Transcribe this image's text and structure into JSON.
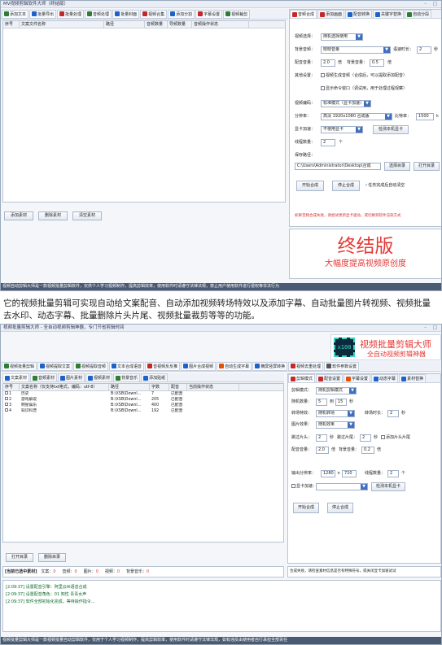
{
  "win1": {
    "title": "MV视频剪辑软件大师（终结版）",
    "win_controls": "– □",
    "toolbar": [
      {
        "label": "添加文本",
        "icon": "add-text-icon",
        "color": "#2e7d32"
      },
      {
        "label": "批量导出",
        "icon": "export-icon",
        "color": "#1e62c9"
      },
      {
        "label": "批量处理",
        "icon": "batch-icon",
        "color": "#c62828"
      },
      {
        "label": "音频处理",
        "icon": "audio-icon",
        "color": "#2e7d32"
      },
      {
        "label": "批量封面",
        "icon": "cover-icon",
        "color": "#1e62c9"
      },
      {
        "label": "视频合集",
        "icon": "merge-icon",
        "color": "#c62828"
      },
      {
        "label": "添加分割",
        "icon": "split-icon",
        "color": "#1e62c9"
      },
      {
        "label": "字幕设置",
        "icon": "subtitle-icon",
        "color": "#c62828"
      },
      {
        "label": "视频裁剪",
        "icon": "crop-icon",
        "color": "#2e7d32"
      }
    ],
    "grid_headers": [
      "序号",
      "文案文件名称",
      "路径",
      "音频数量",
      "导频数量",
      "音频操作状态"
    ],
    "buttons": {
      "add": "添加素材",
      "delete": "删除素材",
      "clear": "清空素材"
    },
    "tabs": [
      {
        "label": "音频合成",
        "icon": "audio-merge-icon",
        "color": "#c62828"
      },
      {
        "label": "添加画面",
        "icon": "picture-icon",
        "color": "#c62828"
      },
      {
        "label": "配音转换",
        "icon": "dub-icon",
        "color": "#1e62c9"
      },
      {
        "label": "关键字替换",
        "icon": "keyword-icon",
        "color": "#1e62c9"
      },
      {
        "label": "自动分段",
        "icon": "segment-icon",
        "color": "#2e7d32"
      }
    ],
    "settings": {
      "mode_label": "视频选择：",
      "mode_value": "随机选择使用",
      "voice_label": "背景音频：",
      "voice_value": "晓晓音量",
      "speed_label": "语速时长：",
      "speed_value": "2",
      "speed_unit": "秒",
      "vol_label": "配音音量：",
      "vol_value": "2.0",
      "vol_unit": "倍",
      "bg_label": "背景音量：",
      "bg_value": "0.5",
      "bg_unit": "倍",
      "other_label": "其他设置：",
      "opt1": "视频生成音频（合成后，可以提取添加配音）",
      "opt2": "显示命令窗口（调试用，用于处理过程观察）",
      "enc_label": "视频编码：",
      "enc_value": "标准模式（显卡加速）",
      "res_label": "分辨率：",
      "res_value": "高清 1920x1080 合成版",
      "ratio_label": "比特率：",
      "ratio_value": "1500",
      "ratio_unit": "k",
      "gpu_label": "显卡加速：",
      "gpu_value": "不使用显卡",
      "gpu_btn": "检测本机显卡",
      "threads_label": "线程数量：",
      "threads_value": "2",
      "threads_unit": "个",
      "out_label": "保存路径：",
      "out_value": "C:\\Users\\Administrator\\Desktop\\合成",
      "browse_btn": "选择目录",
      "open_btn": "打开目录",
      "start_btn": "开始合成",
      "stop_btn": "停止合成",
      "auto_clear": "任务完成后自动清空",
      "warning": "如果音频合成失败，请尝试更新显卡驱动，或切换到软件渲染方式"
    },
    "promo_big": "终结版",
    "promo_small": "大幅度提高视频原创度",
    "status": "视频自动剪辑大师是一款视频批量剪辑软件，仅供个人学习视频制作，提高剪辑效率，使用软件时请遵守法律法规，禁止用户使用软件进行侵权等非法行为"
  },
  "caption": "它的视频批量剪辑可实现自动给文案配音、自动添加视频转场特效以及添加字幕、自动批量图片转视频、视频批量去水印、动态字幕、批量删除片头片尾、视频批量裁剪等等的功能。",
  "win2": {
    "title": "视频批量剪辑大师 - 全自动视频剪辑神器，专门节省剪辑时间",
    "win_controls": "– □",
    "logo_badge": "x100",
    "logo_title": "视频批量剪辑大师",
    "logo_subtitle": "全自动视频剪辑神器",
    "toolbar": [
      {
        "label": "视频批量剪辑",
        "icon": "cut-icon",
        "color": "#2e7d32"
      },
      {
        "label": "视频提取文案",
        "icon": "extract-icon",
        "color": "#1e62c9"
      },
      {
        "label": "视频提取音频",
        "icon": "audio-extract-icon",
        "color": "#2e7d32"
      },
      {
        "label": "文本合成语音",
        "icon": "tts-icon",
        "color": "#1e62c9"
      },
      {
        "label": "音视频反反推",
        "icon": "reverse-icon",
        "color": "#c62828"
      },
      {
        "label": "图片合成视频",
        "icon": "image-video-icon",
        "color": "#1e62c9"
      },
      {
        "label": "自动生成字幕",
        "icon": "auto-subtitle-icon",
        "color": "#e65100"
      },
      {
        "label": "横屏竖屏转换",
        "icon": "rotate-icon",
        "color": "#1e62c9"
      },
      {
        "label": "视频去重处理",
        "icon": "dedupe-icon",
        "color": "#c62828"
      },
      {
        "label": "软件参数设置",
        "icon": "settings-icon",
        "color": "#555"
      }
    ],
    "subtabs": [
      {
        "label": "文案素材",
        "icon": "doc-icon",
        "color": "#1e62c9"
      },
      {
        "label": "音频素材",
        "icon": "music-icon",
        "color": "#2e7d32"
      },
      {
        "label": "图片素材",
        "icon": "image-icon",
        "color": "#1e62c9"
      },
      {
        "label": "视频素材",
        "icon": "video-icon",
        "color": "#1e62c9"
      },
      {
        "label": "背景音乐",
        "icon": "bgm-icon",
        "color": "#2e7d32"
      },
      {
        "label": "添加贴纸",
        "icon": "sticker-icon",
        "color": "#1e62c9"
      }
    ],
    "grid_headers": [
      "序号",
      "文案名称（仅支持txt格式，编码：utf-8）",
      "路径",
      "字数",
      "配音",
      "当前操作状态"
    ],
    "rows": [
      [
        "1",
        "历史",
        "B:\\XSB\\Downl...",
        "7",
        "已配音"
      ],
      [
        "2",
        "游戏解说",
        "B:\\XSB\\Downl...",
        "205",
        "已配音"
      ],
      [
        "3",
        "明星娱乐",
        "B:\\XSB\\Downl...",
        "400",
        "已配音"
      ],
      [
        "4",
        "知识科普",
        "B:\\XSB\\Downl...",
        "192",
        "已配音"
      ]
    ],
    "btn_open": "打开目录",
    "btn_delete": "删除目录",
    "counts": {
      "label": "[当前已选中素材]",
      "text_label": "文案：",
      "text_value": "0",
      "audio_label": "音频：",
      "audio_value": "0",
      "image_label": "图片：",
      "image_value": "0",
      "video_label": "视频：",
      "video_value": "0",
      "bg_label": "背景音乐：",
      "bg_value": "0"
    },
    "tabs": [
      {
        "label": "剪辑模式",
        "icon": "mode-icon",
        "color": "#c62828"
      },
      {
        "label": "配音设置",
        "icon": "mic-icon",
        "color": "#c62828"
      },
      {
        "label": "字幕设置",
        "icon": "font-icon",
        "color": "#e65100"
      },
      {
        "label": "动态字幕",
        "icon": "dynamic-icon",
        "color": "#1e62c9"
      },
      {
        "label": "素材替换",
        "icon": "replace-icon",
        "color": "#1e62c9"
      }
    ],
    "settings": {
      "mode_label": "剪辑模式：",
      "mode_value": "随机剪辑模式",
      "rand_label": "随机数量：",
      "rand_a": "5",
      "rand_sep": "到",
      "rand_b": "15",
      "rand_unit": "秒",
      "trans_label": "转场特效：",
      "trans_value": "随机转场",
      "trans_time_label": "转场时长：",
      "trans_time": "2",
      "trans_unit": "秒",
      "pic_label": "图片效果：",
      "pic_value": "随机效果",
      "head_label": "跳过片头：",
      "head_value": "2",
      "head_unit": "秒",
      "tail_label": "跳过片尾：",
      "tail_value": "2",
      "tail_unit": "秒",
      "add_tail": "添加片头片尾",
      "vol_label": "配音音量：",
      "vol_value": "2.0",
      "vol_unit": "倍",
      "bgvol_label": "背景音量：",
      "bgvol_value": "0.2",
      "bgvol_unit": "倍",
      "res_label": "输出分辨率：",
      "res_w": "1280",
      "res_x": "×",
      "res_h": "720",
      "thread_label": "线程数量：",
      "thread_value": "2",
      "thread_unit": "个",
      "gpu_label": "显卡加速：",
      "gpu_btn": "检测本机显卡",
      "start_btn": "开始合成",
      "stop_btn": "停止合成"
    },
    "result": "合成失败，请检查素材信息是否有特殊符号，或关闭显卡加速试试",
    "log": [
      "[2:09:37] 设置配音引擎：阿里云AI语音合成",
      "[2:09:37] 设置配音角色：01 知性 青青女声",
      "[2:09:37] 软件全部初始化完成，等待操作指令..."
    ],
    "status": "视频批量剪辑大师是一款视频批量自动剪辑软件，仅用于个人学习视频制作，提高剪辑效率，使用软件时请遵守法律法规，如有违反由使用者自行承担全部责任"
  }
}
